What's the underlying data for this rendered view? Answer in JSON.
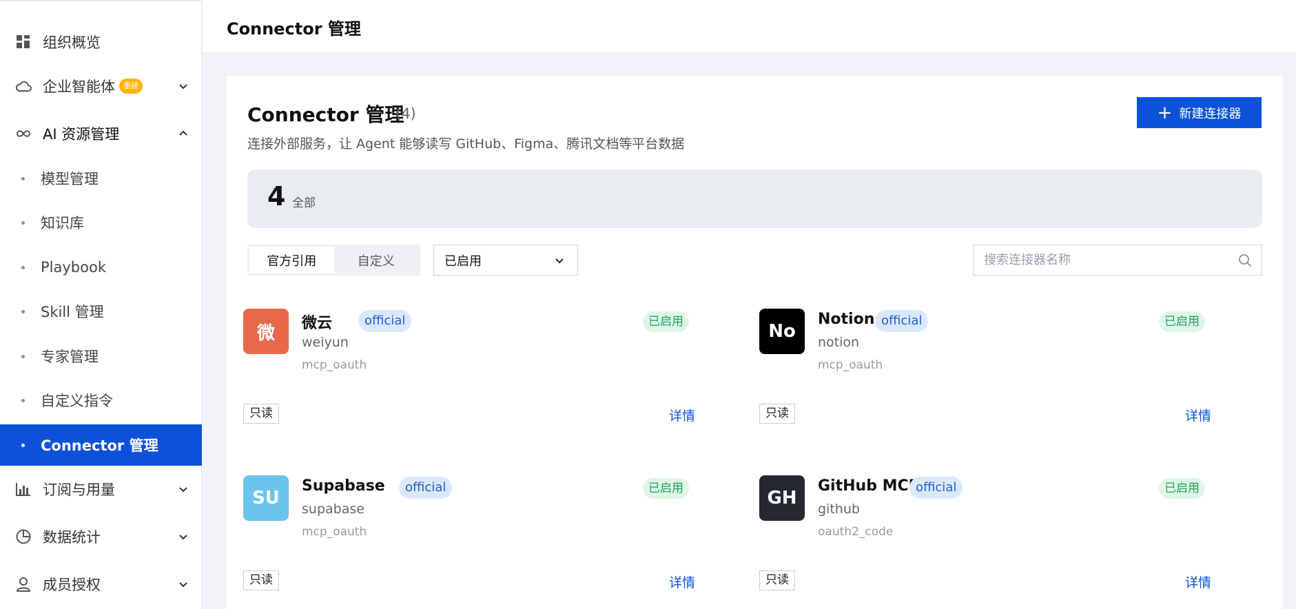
{
  "sidebar": {
    "items": [
      {
        "label": "组织概览",
        "icon": "grid-icon"
      },
      {
        "label": "企业智能体",
        "icon": "cloud-icon",
        "badge": "重磅"
      },
      {
        "label": "AI 资源管理",
        "icon": "infinity-icon",
        "expanded": true
      },
      {
        "label": "订阅与用量",
        "icon": "bar-chart-icon"
      },
      {
        "label": "数据统计",
        "icon": "pie-chart-icon"
      },
      {
        "label": "成员授权",
        "icon": "user-icon"
      }
    ],
    "sub_items": [
      {
        "label": "模型管理"
      },
      {
        "label": "知识库"
      },
      {
        "label": "Playbook"
      },
      {
        "label": "Skill 管理"
      },
      {
        "label": "专家管理"
      },
      {
        "label": "自定义指令"
      },
      {
        "label": "Connector 管理",
        "active": true
      }
    ]
  },
  "header": {
    "title": "Connector 管理"
  },
  "main": {
    "title": "Connector 管理",
    "count": "(4)",
    "description": "连接外部服务，让 Agent 能够读写 GitHub、Figma、腾讯文档等平台数据",
    "new_button": {
      "icon": "+",
      "label": "新建连接器"
    },
    "stats": {
      "total": "4",
      "label": "全部"
    },
    "filters": {
      "segments": [
        "官方引用",
        "自定义"
      ],
      "selected_segment": "官方引用",
      "status_select": "已启用",
      "search_placeholder": "搜索连接器名称"
    },
    "connectors": [
      {
        "logo_text": "微",
        "logo_color": "#e8694a",
        "name": "微云",
        "tag": "official",
        "slug": "weiyun",
        "auth": "mcp_oauth",
        "status": "已启用",
        "permission": "只读",
        "detail": "详情"
      },
      {
        "logo_text": "No",
        "logo_color": "#000000",
        "name": "Notion",
        "tag": "official",
        "slug": "notion",
        "auth": "mcp_oauth",
        "status": "已启用",
        "permission": "只读",
        "detail": "详情"
      },
      {
        "logo_text": "SU",
        "logo_color": "#6cc3ec",
        "name": "Supabase",
        "tag": "official",
        "slug": "supabase",
        "auth": "mcp_oauth",
        "status": "已启用",
        "permission": "只读",
        "detail": "详情"
      },
      {
        "logo_text": "GH",
        "logo_color": "#24292f",
        "name": "GitHub MCP",
        "tag": "official",
        "slug": "github",
        "auth": "oauth2_code",
        "status": "已启用",
        "permission": "只读",
        "detail": "详情"
      }
    ]
  },
  "colors": {
    "accent": "#0b52d9",
    "enabled_green": "#1fa35a",
    "official_blue": "#1d5fd6"
  }
}
